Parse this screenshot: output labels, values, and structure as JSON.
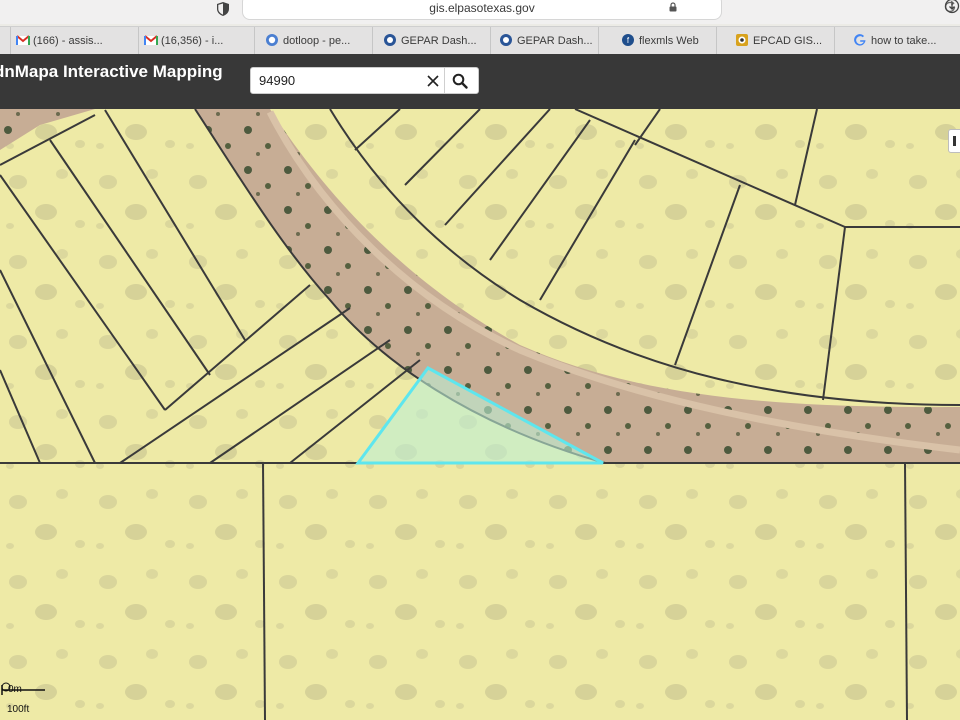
{
  "browser": {
    "url": "gis.elpasotexas.gov",
    "tabs": [
      {
        "icon": "gmail-icon",
        "label": "(166) - assis..."
      },
      {
        "icon": "gmail-icon",
        "label": "(16,356) - i..."
      },
      {
        "icon": "dotloop-icon",
        "label": "dotloop - pe..."
      },
      {
        "icon": "gepar-icon",
        "label": "GEPAR Dash..."
      },
      {
        "icon": "gepar-icon",
        "label": "GEPAR Dash..."
      },
      {
        "icon": "flexmls-icon",
        "label": "flexmls Web"
      },
      {
        "icon": "epcad-icon",
        "label": "EPCAD GIS..."
      },
      {
        "icon": "google-icon",
        "label": "how to take..."
      }
    ]
  },
  "app": {
    "title": "dnMapa Interactive Mapping",
    "search": {
      "value": "94990",
      "placeholder": ""
    }
  },
  "map": {
    "parcel_fill_color": "#f1eeaa",
    "parcel_line_color": "#3a3a3a",
    "highlight_color": "#5ee6ee",
    "road_color": "#b39a84",
    "scale": {
      "metric_label": "0m",
      "imperial_label": "100ft"
    }
  }
}
